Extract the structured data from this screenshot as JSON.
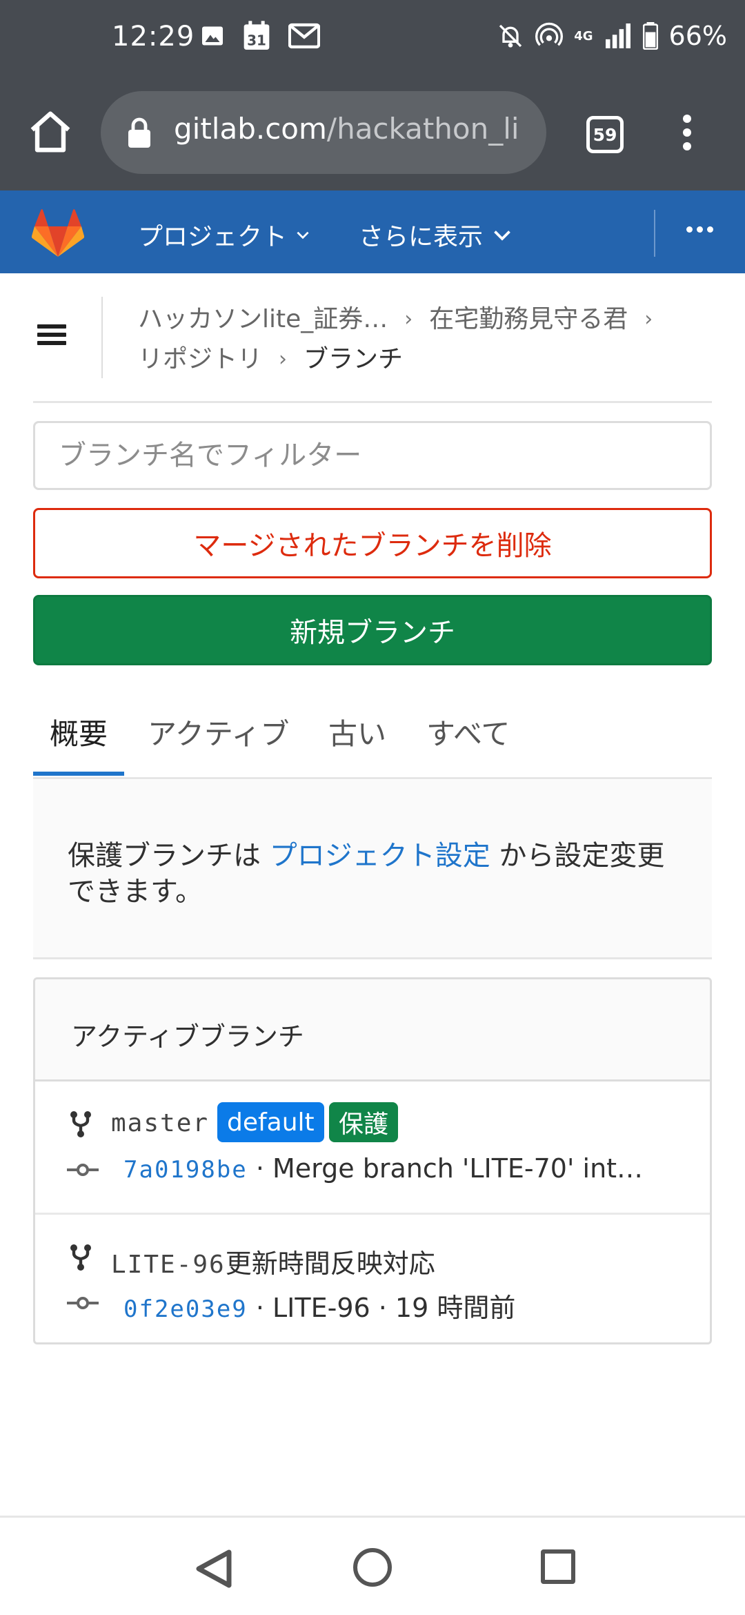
{
  "status_bar": {
    "time": "12:29",
    "calendar_day": "31",
    "network": "4G",
    "battery": "66%"
  },
  "browser": {
    "url_host": "gitlab.com",
    "url_path": "/hackathon_li",
    "tab_count": "59"
  },
  "header": {
    "projects_label": "プロジェクト",
    "more_label": "さらに表示"
  },
  "breadcrumb": {
    "group": "ハッカソンlite_証券…",
    "project": "在宅勤務見守る君",
    "repository": "リポジトリ",
    "current": "ブランチ"
  },
  "filter": {
    "placeholder": "ブランチ名でフィルター"
  },
  "buttons": {
    "delete_merged": "マージされたブランチを削除",
    "new_branch": "新規ブランチ"
  },
  "tabs": [
    {
      "label": "概要"
    },
    {
      "label": "アクティブ"
    },
    {
      "label": "古い"
    },
    {
      "label": "すべて"
    }
  ],
  "info": {
    "prefix": "保護ブランチは ",
    "link": "プロジェクト設定",
    "suffix": " から設定変更できます。"
  },
  "card": {
    "title": "アクティブブランチ",
    "branches": [
      {
        "name": "master",
        "badge_default": "default",
        "badge_protected": "保護",
        "sha": "7a0198be",
        "commit_text": " · Merge branch 'LITE-70' int…"
      },
      {
        "name_code": "LITE-96",
        "name_suffix": "更新時間反映対応",
        "sha": "0f2e03e9",
        "commit_text": " · LITE-96 · 19 時間前"
      }
    ]
  },
  "colors": {
    "gitlab_header": "#2464ae",
    "danger": "#dd2b0e",
    "success": "#108548",
    "link": "#1f75cb"
  }
}
